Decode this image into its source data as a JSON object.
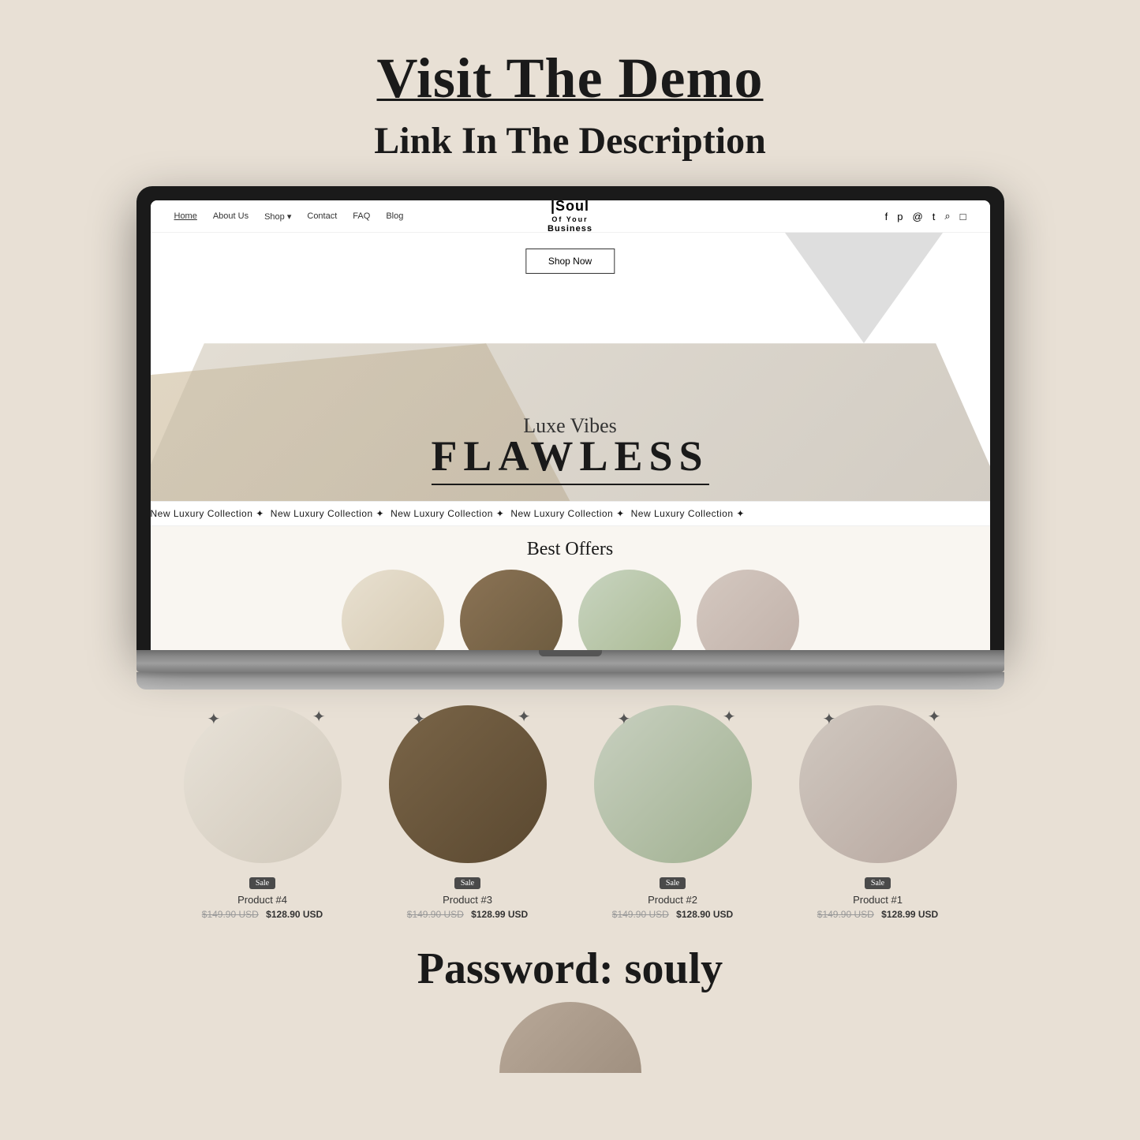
{
  "page": {
    "background_color": "#e8e0d5"
  },
  "header": {
    "title": "Visit The Demo",
    "subtitle": "Link In The Description"
  },
  "website": {
    "nav": {
      "links": [
        "Home",
        "About Us",
        "Shop",
        "Contact",
        "FAQ",
        "Blog"
      ],
      "active_link": "Home",
      "logo_line1": "Soul",
      "logo_line2": "Of Your Business",
      "icons": [
        "facebook",
        "pinterest",
        "instagram",
        "tiktok",
        "search",
        "cart"
      ]
    },
    "hero": {
      "shop_now_label": "Shop Now",
      "luxe_vibes": "Luxe Vibes",
      "flawless": "FLAWLESS"
    },
    "marquee": {
      "items": [
        "New Luxury Collection ✦",
        "New Luxury Collection ✦",
        "New Luxury Collection ✦",
        "New Luxury Collection ✦",
        "New Luxury Collection ✦",
        "New Luxury Collection ✦"
      ]
    },
    "best_offers": {
      "title": "Best Offers"
    }
  },
  "products": [
    {
      "name": "Product #4",
      "old_price": "$149.90 USD",
      "new_price": "$128.90 USD",
      "sale_label": "Sale",
      "color_class": "product-circle-large-1"
    },
    {
      "name": "Product #3",
      "old_price": "$149.90 USD",
      "new_price": "$128.99 USD",
      "sale_label": "Sale",
      "color_class": "product-circle-large-2"
    },
    {
      "name": "Product #2",
      "old_price": "$149.90 USD",
      "new_price": "$128.90 USD",
      "sale_label": "Sale",
      "color_class": "product-circle-large-3"
    },
    {
      "name": "Product #1",
      "old_price": "$149.90 USD",
      "new_price": "$128.99 USD",
      "sale_label": "Sale",
      "color_class": "product-circle-large-4"
    }
  ],
  "password_section": {
    "text": "Password: souly"
  }
}
